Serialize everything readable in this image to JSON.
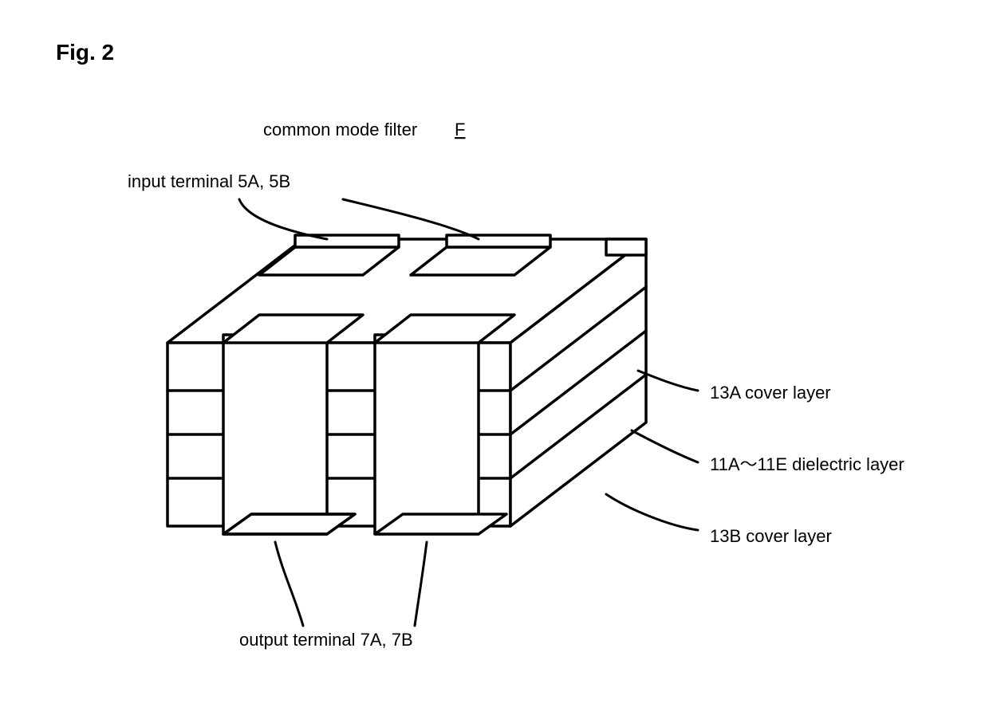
{
  "figure_label": "Fig. 2",
  "title": {
    "text": "common mode filter",
    "symbol": "F"
  },
  "labels": {
    "input_terminal": "input terminal 5A, 5B",
    "output_terminal": "output terminal 7A, 7B",
    "cover_layer_top": "13A cover layer",
    "dielectric_layer": "11A～11E dielectric layer",
    "cover_layer_bottom": "13B cover layer"
  }
}
